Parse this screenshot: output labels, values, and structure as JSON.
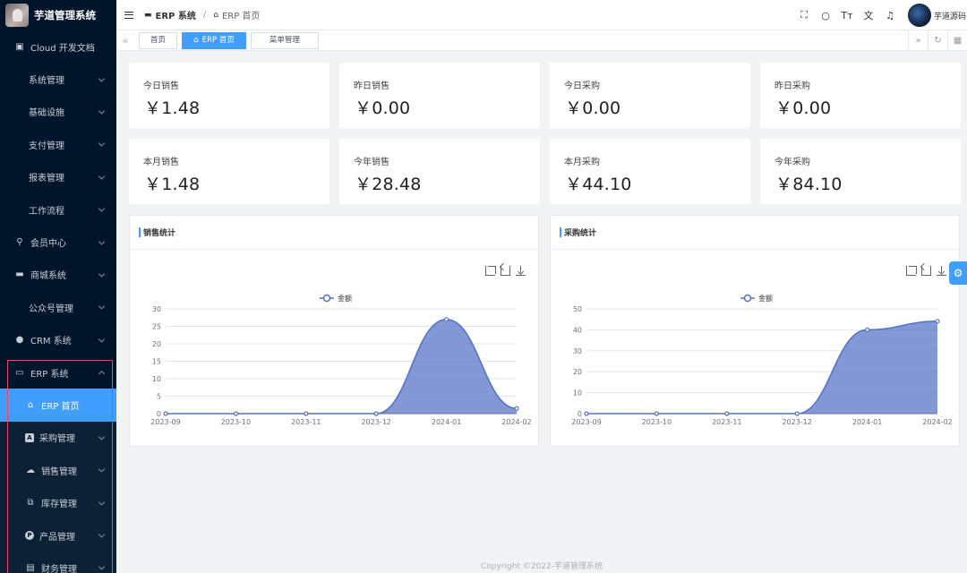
{
  "brand": {
    "title": "芋道管理系统"
  },
  "sidebar": {
    "items": [
      {
        "label": "Cloud 开发文档",
        "icon": "document-icon"
      },
      {
        "label": "系统管理"
      },
      {
        "label": "基础设施"
      },
      {
        "label": "支付管理"
      },
      {
        "label": "报表管理"
      },
      {
        "label": "工作流程"
      },
      {
        "label": "会员中心",
        "icon": "bicycle-icon"
      },
      {
        "label": "商城系统",
        "icon": "shop-icon"
      },
      {
        "label": "公众号管理"
      },
      {
        "label": "CRM 系统",
        "icon": "user-icon"
      },
      {
        "label": "ERP 系统",
        "icon": "erp-icon"
      },
      {
        "label": "ERP 首页",
        "icon": "home-icon"
      },
      {
        "label": "采购管理",
        "icon": "purchase-icon"
      },
      {
        "label": "销售管理",
        "icon": "cloud-icon"
      },
      {
        "label": "库存管理",
        "icon": "stock-icon"
      },
      {
        "label": "产品管理",
        "icon": "product-icon"
      },
      {
        "label": "财务管理",
        "icon": "finance-icon"
      }
    ]
  },
  "navbar": {
    "breadcrumb": [
      "ERP 系统",
      "ERP 首页"
    ],
    "username": "芋道源码",
    "icons": [
      "fullscreen-icon",
      "search-icon",
      "font-size-icon",
      "translate-icon",
      "bell-icon"
    ]
  },
  "tags": [
    "首页",
    "ERP 首页",
    "菜单管理"
  ],
  "stats": [
    {
      "label": "今日销售",
      "value": "￥1.48"
    },
    {
      "label": "昨日销售",
      "value": "￥0.00"
    },
    {
      "label": "今日采购",
      "value": "￥0.00"
    },
    {
      "label": "昨日采购",
      "value": "￥0.00"
    },
    {
      "label": "本月销售",
      "value": "￥1.48"
    },
    {
      "label": "今年销售",
      "value": "￥28.48"
    },
    {
      "label": "本月采购",
      "value": "￥44.10"
    },
    {
      "label": "今年采购",
      "value": "￥84.10"
    }
  ],
  "panels": [
    {
      "title": "销售统计"
    },
    {
      "title": "采购统计"
    }
  ],
  "chart_data": [
    {
      "type": "area",
      "title": "销售统计",
      "categories": [
        "2023-09",
        "2023-10",
        "2023-11",
        "2023-12",
        "2024-01",
        "2024-02"
      ],
      "series": [
        {
          "name": "金额",
          "values": [
            0,
            0,
            0,
            0,
            27,
            1.48
          ]
        }
      ],
      "ylim": [
        0,
        30
      ],
      "yticks": [
        0,
        5,
        10,
        15,
        20,
        25,
        30
      ],
      "smooth": true,
      "legend": "top-center",
      "grid": true,
      "color": "#5470c6"
    },
    {
      "type": "area",
      "title": "采购统计",
      "categories": [
        "2023-09",
        "2023-10",
        "2023-11",
        "2023-12",
        "2024-01",
        "2024-02"
      ],
      "series": [
        {
          "name": "金额",
          "values": [
            0,
            0,
            0,
            0,
            40,
            44.1
          ]
        }
      ],
      "ylim": [
        0,
        50
      ],
      "yticks": [
        0,
        10,
        20,
        30,
        40,
        50
      ],
      "smooth": true,
      "legend": "top-center",
      "grid": true,
      "color": "#5470c6"
    }
  ],
  "footer": "Copyright ©2022-芋道管理系统"
}
